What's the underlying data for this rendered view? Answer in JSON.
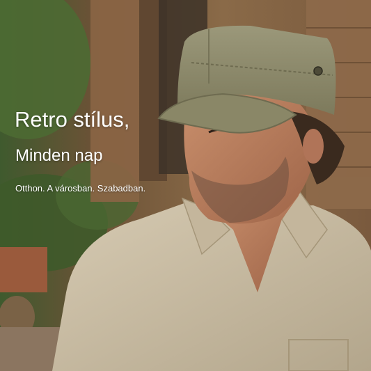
{
  "image": {
    "subject": "man-wearing-military-cap",
    "colors": {
      "cap": "#8f8c6c",
      "shirt": "#c9bca4",
      "wood": "#7b5a3c",
      "foliage": "#4d6a33",
      "text": "#ffffff"
    }
  },
  "overlay": {
    "headline": "Retro stílus,",
    "subheadline": "Minden nap",
    "tagline": "Otthon. A városban. Szabadban."
  }
}
